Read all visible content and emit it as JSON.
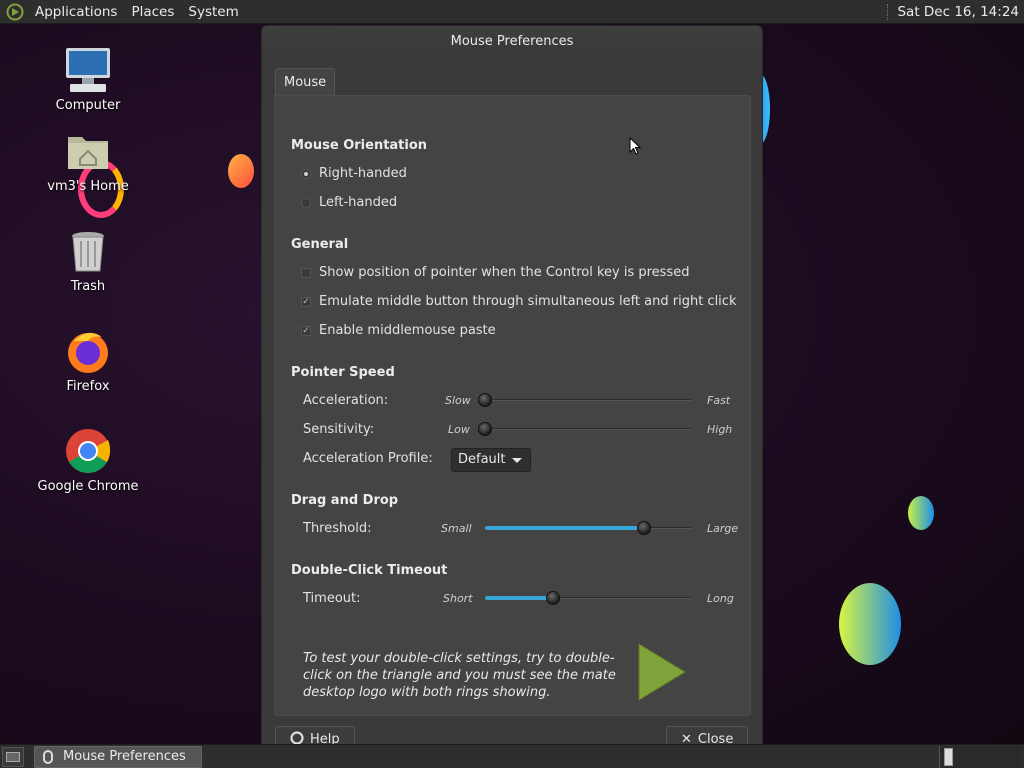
{
  "top_panel": {
    "menus": [
      "Applications",
      "Places",
      "System"
    ],
    "clock": "Sat Dec 16, 14:24"
  },
  "desktop": {
    "icons": [
      {
        "label": "Computer",
        "icon": "computer-icon"
      },
      {
        "label": "vm3's Home",
        "icon": "home-folder-icon"
      },
      {
        "label": "Trash",
        "icon": "trash-icon"
      },
      {
        "label": "Firefox",
        "icon": "firefox-icon"
      },
      {
        "label": "Google Chrome",
        "icon": "chrome-icon"
      }
    ]
  },
  "window": {
    "title": "Mouse Preferences",
    "tab": "Mouse",
    "orientation": {
      "title": "Mouse Orientation",
      "right_handed": "Right-handed",
      "left_handed": "Left-handed",
      "selected": "Right-handed"
    },
    "general": {
      "title": "General",
      "show_pointer": {
        "label": "Show position of pointer when the Control key is pressed",
        "checked": false
      },
      "emulate_middle": {
        "label": "Emulate middle button through simultaneous left and right click",
        "checked": true
      },
      "middle_paste": {
        "label": "Enable middlemouse paste",
        "checked": true
      }
    },
    "pointer_speed": {
      "title": "Pointer Speed",
      "acceleration": {
        "label": "Acceleration:",
        "min_label": "Slow",
        "max_label": "Fast",
        "value": 0.0
      },
      "sensitivity": {
        "label": "Sensitivity:",
        "min_label": "Low",
        "max_label": "High",
        "value": 0.0
      },
      "profile": {
        "label": "Acceleration Profile:",
        "value": "Default"
      }
    },
    "drag_drop": {
      "title": "Drag and Drop",
      "threshold": {
        "label": "Threshold:",
        "min_label": "Small",
        "max_label": "Large",
        "value": 0.77
      }
    },
    "double_click": {
      "title": "Double-Click Timeout",
      "timeout": {
        "label": "Timeout:",
        "min_label": "Short",
        "max_label": "Long",
        "value": 0.33
      },
      "test_text": "To test your double-click settings, try to double-click on the triangle and you must see the mate desktop logo with both rings showing."
    },
    "buttons": {
      "help": "Help",
      "close": "Close"
    }
  },
  "taskbar": {
    "item": "Mouse Preferences"
  },
  "colors": {
    "accent": "#36a6d6",
    "panel": "#2e2e2e",
    "window": "#3a3a3a",
    "triangle": "#7fa33a"
  }
}
